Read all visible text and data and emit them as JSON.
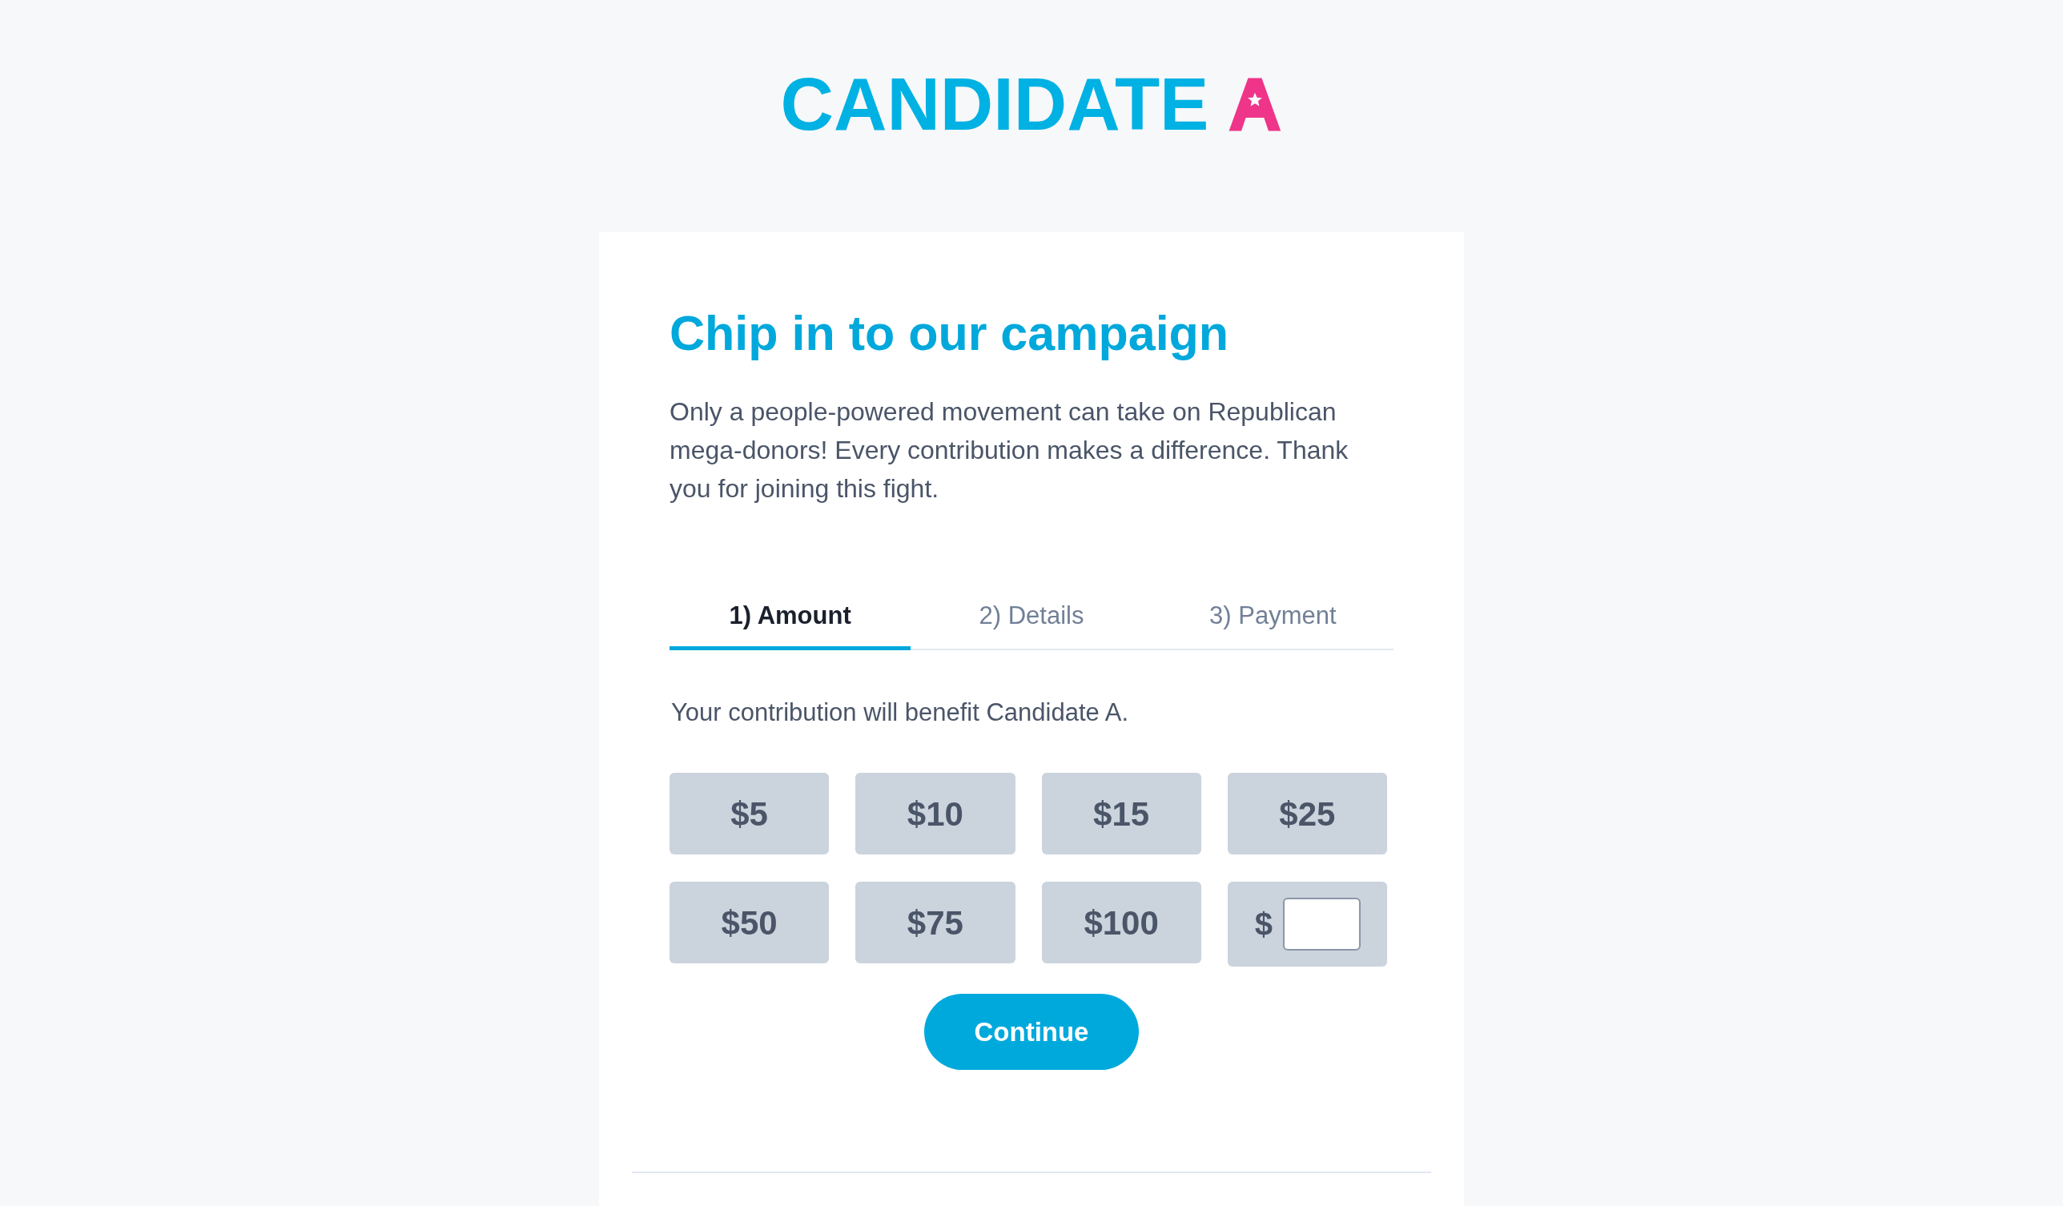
{
  "logo": {
    "name": "CANDIDATE",
    "letter": "A"
  },
  "card": {
    "title": "Chip in to our campaign",
    "intro": "Only a people-powered movement can take on Republican mega-donors! Every contribution makes a difference. Thank you for joining this fight.",
    "tabs": [
      {
        "label": "1) Amount",
        "selected": true
      },
      {
        "label": "2) Details",
        "selected": false
      },
      {
        "label": "3) Payment",
        "selected": false
      }
    ],
    "beneficiary_note": "Your contribution will benefit Candidate A.",
    "amounts": [
      {
        "label": "$5",
        "selected": false
      },
      {
        "label": "$10",
        "selected": false
      },
      {
        "label": "$15",
        "selected": false
      },
      {
        "label": "$25",
        "selected": false
      },
      {
        "label": "$50",
        "selected": false
      },
      {
        "label": "$75",
        "selected": false
      },
      {
        "label": "$100",
        "selected": false
      }
    ],
    "custom_amount": {
      "prefix": "$"
    },
    "continue_button": "Continue"
  }
}
